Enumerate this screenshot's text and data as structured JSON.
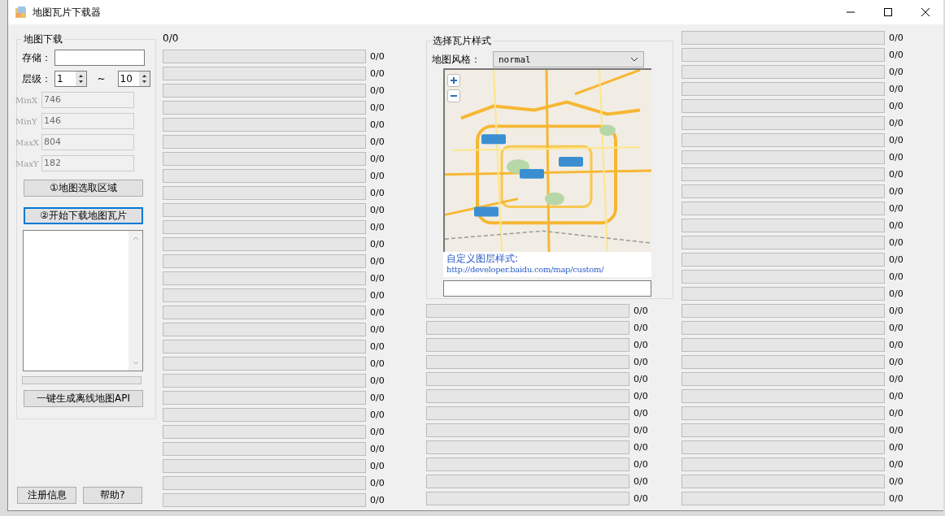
{
  "window": {
    "title": "地图瓦片下载器"
  },
  "download_panel": {
    "title": "地图下载",
    "storage": {
      "label": "存储："
    },
    "level_range": {
      "label": "层级：",
      "from": "1",
      "separator": "~",
      "to": "10"
    },
    "bounds": [
      {
        "label": "MinX",
        "value": "746",
        "disabled": true
      },
      {
        "label": "MinY",
        "value": "146",
        "disabled": true
      },
      {
        "label": "MaxX",
        "value": "804",
        "disabled": true
      },
      {
        "label": "MaxY",
        "value": "182",
        "disabled": true
      }
    ],
    "select_area_button": {
      "label": "①地图选取区域",
      "focused": false
    },
    "start_button": {
      "label": "②开始下载地图瓦片",
      "focused": true
    },
    "progress": {
      "level": 0
    },
    "generate_api_button": {
      "label": "一键生成离线地图API",
      "focused": false
    }
  },
  "footer_buttons": [
    "注册信息",
    "帮助?"
  ],
  "tile_style": {
    "title": "选择瓦片样式",
    "style_label": "地图风格：",
    "style_value": "normal",
    "custom_label": "自定义图层样式:",
    "custom_link": "http://developer.baidu.com/map/custom/"
  },
  "counter": "0/0",
  "columns": [
    {
      "rows": [
        {
          "level": 0,
          "reading": "0/0"
        },
        {
          "level": 0,
          "reading": "0/0"
        },
        {
          "level": 0,
          "reading": "0/0"
        },
        {
          "level": 0,
          "reading": "0/0"
        },
        {
          "level": 0,
          "reading": "0/0"
        },
        {
          "level": 0,
          "reading": "0/0"
        },
        {
          "level": 0,
          "reading": "0/0"
        },
        {
          "level": 0,
          "reading": "0/0"
        },
        {
          "level": 0,
          "reading": "0/0"
        },
        {
          "level": 0,
          "reading": "0/0"
        },
        {
          "level": 0,
          "reading": "0/0"
        },
        {
          "level": 0,
          "reading": "0/0"
        },
        {
          "level": 0,
          "reading": "0/0"
        },
        {
          "level": 0,
          "reading": "0/0"
        },
        {
          "level": 0,
          "reading": "0/0"
        },
        {
          "level": 0,
          "reading": "0/0"
        },
        {
          "level": 0,
          "reading": "0/0"
        },
        {
          "level": 0,
          "reading": "0/0"
        },
        {
          "level": 0,
          "reading": "0/0"
        },
        {
          "level": 0,
          "reading": "0/0"
        },
        {
          "level": 0,
          "reading": "0/0"
        },
        {
          "level": 0,
          "reading": "0/0"
        },
        {
          "level": 0,
          "reading": "0/0"
        },
        {
          "level": 0,
          "reading": "0/0"
        },
        {
          "level": 0,
          "reading": "0/0"
        },
        {
          "level": 0,
          "reading": "0/0"
        },
        {
          "level": 0,
          "reading": "0/0"
        }
      ]
    },
    {
      "rows": [
        {
          "level": 0,
          "reading": "0/0"
        },
        {
          "level": 0,
          "reading": "0/0"
        },
        {
          "level": 0,
          "reading": "0/0"
        },
        {
          "level": 0,
          "reading": "0/0"
        },
        {
          "level": 0,
          "reading": "0/0"
        },
        {
          "level": 0,
          "reading": "0/0"
        },
        {
          "level": 0,
          "reading": "0/0"
        },
        {
          "level": 0,
          "reading": "0/0"
        },
        {
          "level": 0,
          "reading": "0/0"
        },
        {
          "level": 0,
          "reading": "0/0"
        },
        {
          "level": 0,
          "reading": "0/0"
        },
        {
          "level": 0,
          "reading": "0/0"
        }
      ]
    },
    {
      "rows": [
        {
          "level": 0,
          "reading": "0/0"
        },
        {
          "level": 0,
          "reading": "0/0"
        },
        {
          "level": 0,
          "reading": "0/0"
        },
        {
          "level": 0,
          "reading": "0/0"
        },
        {
          "level": 0,
          "reading": "0/0"
        },
        {
          "level": 0,
          "reading": "0/0"
        },
        {
          "level": 0,
          "reading": "0/0"
        },
        {
          "level": 0,
          "reading": "0/0"
        },
        {
          "level": 0,
          "reading": "0/0"
        },
        {
          "level": 0,
          "reading": "0/0"
        },
        {
          "level": 0,
          "reading": "0/0"
        },
        {
          "level": 0,
          "reading": "0/0"
        },
        {
          "level": 0,
          "reading": "0/0"
        },
        {
          "level": 0,
          "reading": "0/0"
        },
        {
          "level": 0,
          "reading": "0/0"
        },
        {
          "level": 0,
          "reading": "0/0"
        },
        {
          "level": 0,
          "reading": "0/0"
        },
        {
          "level": 0,
          "reading": "0/0"
        },
        {
          "level": 0,
          "reading": "0/0"
        },
        {
          "level": 0,
          "reading": "0/0"
        },
        {
          "level": 0,
          "reading": "0/0"
        },
        {
          "level": 0,
          "reading": "0/0"
        },
        {
          "level": 0,
          "reading": "0/0"
        },
        {
          "level": 0,
          "reading": "0/0"
        },
        {
          "level": 0,
          "reading": "0/0"
        },
        {
          "level": 0,
          "reading": "0/0"
        },
        {
          "level": 0,
          "reading": "0/0"
        },
        {
          "level": 0,
          "reading": "0/0"
        }
      ]
    }
  ]
}
